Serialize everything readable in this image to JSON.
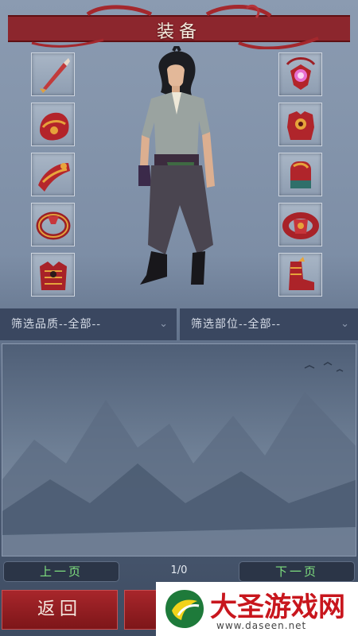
{
  "header": {
    "title": "装备"
  },
  "equipment_slots": {
    "left": [
      {
        "icon": "dagger-icon"
      },
      {
        "icon": "helmet-icon"
      },
      {
        "icon": "gauntlet-icon"
      },
      {
        "icon": "ring-icon"
      },
      {
        "icon": "chest-armor-icon"
      }
    ],
    "right": [
      {
        "icon": "amulet-icon"
      },
      {
        "icon": "armor-icon"
      },
      {
        "icon": "bracer-icon"
      },
      {
        "icon": "belt-icon"
      },
      {
        "icon": "boots-icon"
      }
    ]
  },
  "filters": {
    "quality": "筛选品质--全部--",
    "slot": "筛选部位--全部--"
  },
  "pagination": {
    "prev_label": "上一页",
    "next_label": "下一页",
    "indicator": "1/0"
  },
  "actions": {
    "back_label": "返回"
  },
  "watermark": {
    "title": "大圣游戏网",
    "url": "www.daseen.net"
  },
  "colors": {
    "title_red": "#8c1c22",
    "page_button_text": "#7fe07f",
    "action_red": "#a8262b",
    "watermark_red": "#c8161d"
  }
}
